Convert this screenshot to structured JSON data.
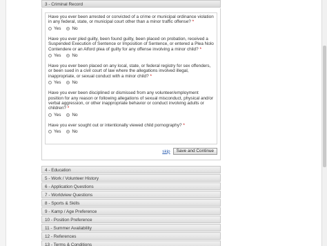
{
  "criminal_section": {
    "title": "3 - Criminal Record",
    "questions": [
      {
        "text": "Have you ever been arrested or convicted of a crime or municipal ordinance violation in any federal, state, or municipal court other than a minor traffic offense?",
        "required": "*",
        "options": [
          "Yes",
          "No"
        ],
        "selected": "No"
      },
      {
        "text": "Have you ever pled guilty, been found guilty, been placed on probation, received a Suspended Execution of Sentence or Imposition of Sentence, or entered a Plea Nolo Contendere or an Alford plea of guilty for any offense involving a minor child?",
        "required": "*",
        "options": [
          "Yes",
          "No"
        ],
        "selected": "No"
      },
      {
        "text": "Have you ever been placed on any local, state, or federal registry for sex offenders, or been sued in a civil court of law where the allegations involved illegal, inappropriate, or sexual conduct with a minor child?",
        "required": "*",
        "options": [
          "Yes",
          "No"
        ],
        "selected": "No"
      },
      {
        "text": "Have you ever been disciplined or dismissed from any volunteer/employment position for any reason or following allegations of sexual misconduct, physical and/or verbal aggression, or other inappropriate behavior or conduct involving adults or children?",
        "required": "*",
        "options": [
          "Yes",
          "No"
        ],
        "selected": "No"
      },
      {
        "text": "Have you ever sought out or intentionally viewed child pornography?",
        "required": "*",
        "options": [
          "Yes",
          "No"
        ],
        "selected": "No"
      }
    ],
    "skip_label": "skip",
    "save_label": "Save and Continue"
  },
  "collapsed_sections": [
    "4 - Education",
    "5 - Work / Volunteer History",
    "6 - Application Questions",
    "7 - Worldview Questions",
    "8 - Sports & Skills",
    "9 - Kamp / Age Preference",
    "10 - Position Preference",
    "11 - Summer Availability",
    "12 - References",
    "13 - Terms & Conditions"
  ]
}
